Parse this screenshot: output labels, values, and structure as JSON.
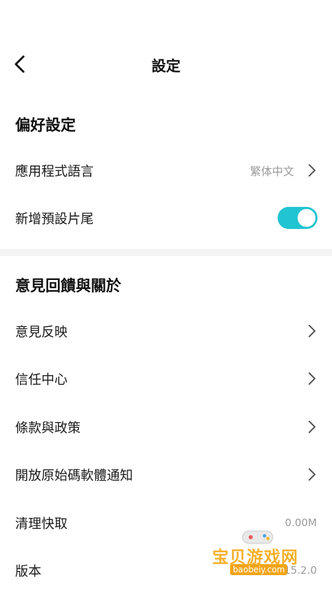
{
  "header": {
    "title": "設定",
    "back_icon": "chevron-left-icon"
  },
  "preferences": {
    "title": "偏好設定",
    "app_language": {
      "label": "應用程式語言",
      "value": "繁体中文"
    },
    "add_default_ending": {
      "label": "新增預設片尾",
      "enabled": true
    }
  },
  "feedback": {
    "title": "意見回饋與關於",
    "items": [
      {
        "label": "意見反映"
      },
      {
        "label": "信任中心"
      },
      {
        "label": "條款與政策"
      },
      {
        "label": "開放原始碼軟體通知"
      }
    ],
    "clear_cache": {
      "label": "清理快取",
      "value": "0.00M"
    },
    "version": {
      "label": "版本",
      "value": "15.2.0"
    }
  },
  "colors": {
    "accent": "#21c4d2",
    "divider": "#f3f3f3",
    "muted": "#9a9a9a"
  },
  "watermark": {
    "text": "宝贝游戏网",
    "url": "baobeiy.com"
  }
}
